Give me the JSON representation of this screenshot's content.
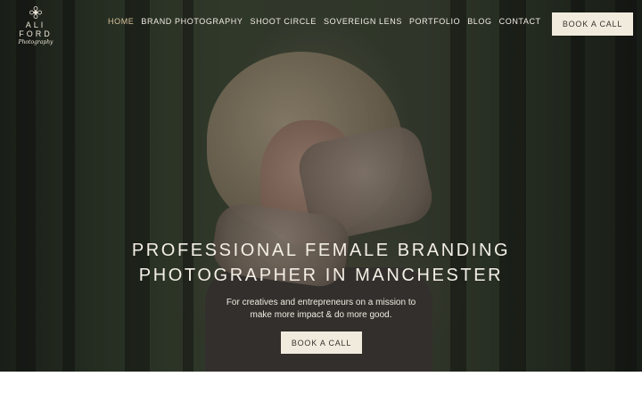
{
  "logo": {
    "name": "ALI FORD",
    "subtitle": "Photography"
  },
  "nav": {
    "items": [
      {
        "label": "HOME",
        "active": true
      },
      {
        "label": "BRAND PHOTOGRAPHY"
      },
      {
        "label": "SHOOT CIRCLE"
      },
      {
        "label": "SOVEREIGN LENS"
      },
      {
        "label": "PORTFOLIO"
      },
      {
        "label": "BLOG"
      },
      {
        "label": "CONTACT"
      }
    ],
    "active_color": "#d8c39b"
  },
  "header": {
    "cta_label": "BOOK A CALL"
  },
  "hero": {
    "headline_line1": "PROFESSIONAL FEMALE BRANDING",
    "headline_line2": "PHOTOGRAPHER IN MANCHESTER",
    "tagline_line1": "For creatives and entrepreneurs on a mission to",
    "tagline_line2": "make more impact & do more good.",
    "cta_label": "BOOK A CALL",
    "button_color": "#f1ebdd"
  }
}
